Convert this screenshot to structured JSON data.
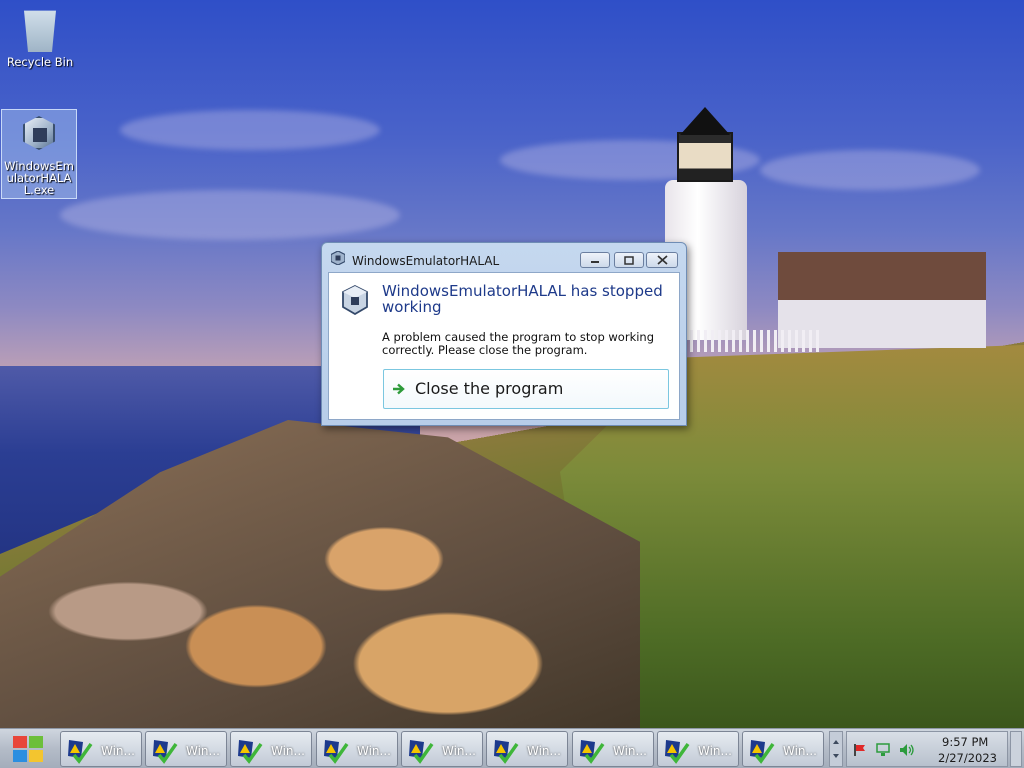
{
  "desktop": {
    "icons": [
      {
        "label": "Recycle Bin",
        "icon": "recycle-bin-icon"
      },
      {
        "label": "WindowsEmulatorHALAL.exe",
        "icon": "virtualbox-cube-icon",
        "selected": true
      }
    ]
  },
  "dialog": {
    "title": "WindowsEmulatorHALAL",
    "heading": "WindowsEmulatorHALAL has stopped working",
    "description": "A problem caused the program to stop working correctly. Please close the program.",
    "action_label": "Close the program",
    "buttons": {
      "minimize": "minimize-icon",
      "maximize": "maximize-icon",
      "close": "close-icon"
    }
  },
  "taskbar": {
    "start_icon": "windows-logo-icon",
    "buttons": [
      {
        "label": "Win..."
      },
      {
        "label": "Win..."
      },
      {
        "label": "Win..."
      },
      {
        "label": "Win..."
      },
      {
        "label": "Win..."
      },
      {
        "label": "Win..."
      },
      {
        "label": "Win..."
      },
      {
        "label": "Win..."
      },
      {
        "label": "Win..."
      }
    ],
    "tray": {
      "time": "9:57 PM",
      "date": "2/27/2023",
      "icons": [
        "action-center-flag-icon",
        "network-icon",
        "volume-icon"
      ]
    }
  },
  "colors": {
    "heading_blue": "#1e3a8a",
    "dialog_frame": "#b7cde9",
    "action_border": "#7bc7e0"
  }
}
